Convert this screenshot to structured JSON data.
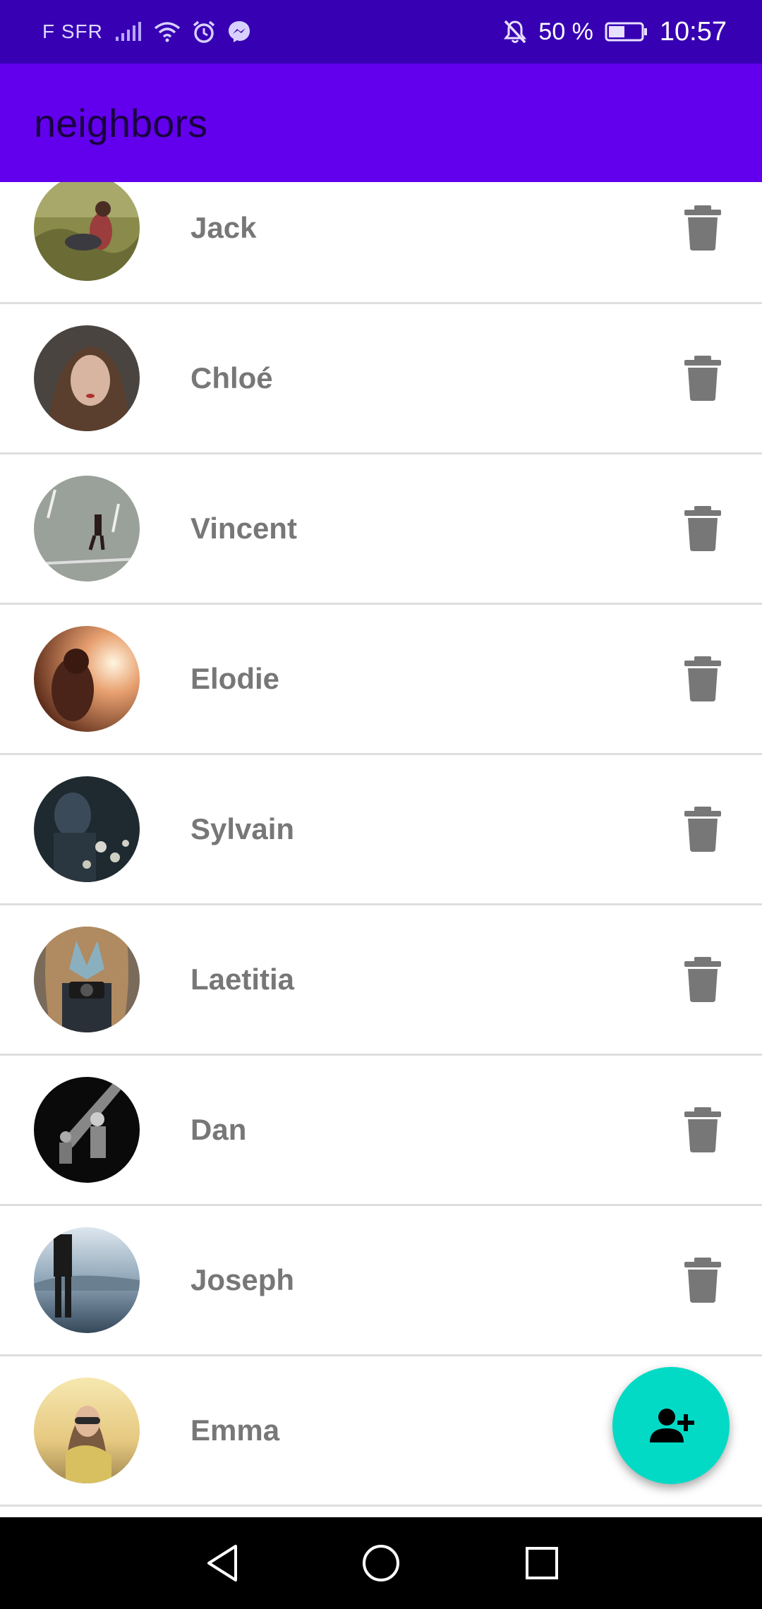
{
  "status_bar": {
    "carrier": "F SFR",
    "battery": "50 %",
    "time": "10:57",
    "icons": [
      "signal-icon",
      "wifi-icon",
      "alarm-icon",
      "messenger-icon",
      "bell-off-icon",
      "battery-icon"
    ]
  },
  "app_bar": {
    "title": "neighbors"
  },
  "neighbors": [
    {
      "name": "Jack",
      "avatar": "grass-field-photo"
    },
    {
      "name": "Chloé",
      "avatar": "woman-portrait-photo"
    },
    {
      "name": "Vincent",
      "avatar": "street-walker-photo"
    },
    {
      "name": "Elodie",
      "avatar": "sunset-photo"
    },
    {
      "name": "Sylvain",
      "avatar": "hooded-figure-photo"
    },
    {
      "name": "Laetitia",
      "avatar": "camera-photo"
    },
    {
      "name": "Dan",
      "avatar": "concert-photo"
    },
    {
      "name": "Joseph",
      "avatar": "lake-silhouette-photo"
    },
    {
      "name": "Emma",
      "avatar": "sunglasses-photo"
    }
  ],
  "fab": {
    "icon": "person-add-icon"
  },
  "nav_bar": {
    "icons": [
      "back-icon",
      "home-icon",
      "recents-icon"
    ]
  },
  "colors": {
    "status_bar": "#3700b3",
    "app_bar": "#6200ee",
    "fab": "#03dac5",
    "name_text": "#777777",
    "delete_icon": "#777777"
  }
}
